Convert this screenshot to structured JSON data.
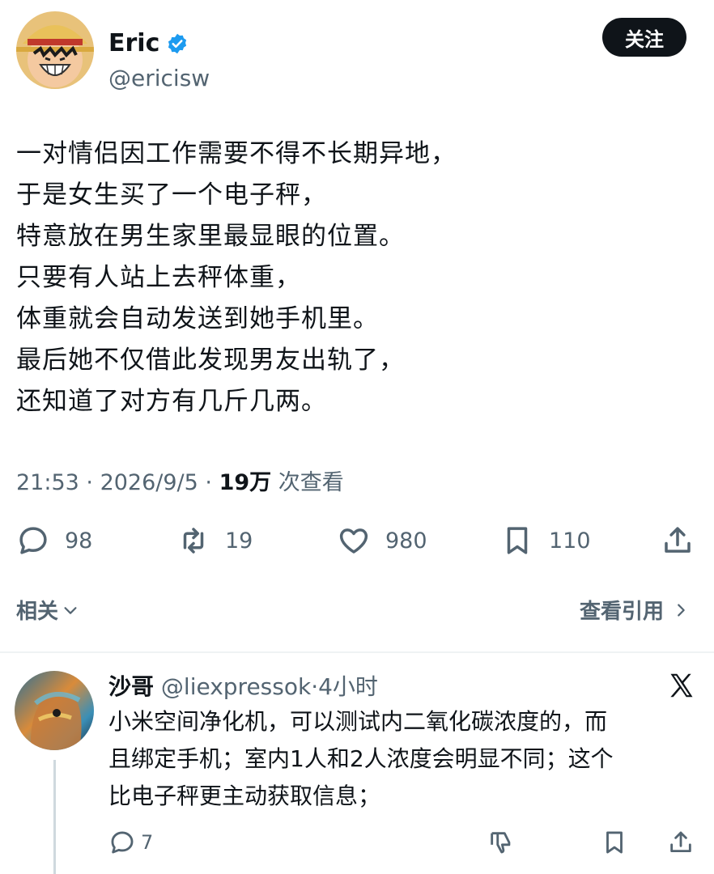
{
  "post": {
    "author": {
      "name": "Eric",
      "handle": "@ericisw"
    },
    "follow_label": "关注",
    "lines": [
      "一对情侣因工作需要不得不长期异地，",
      "于是女生买了一个电子秤，",
      "特意放在男生家里最显眼的位置。",
      "只要有人站上去秤体重，",
      "体重就会自动发送到她手机里。",
      "最后她不仅借此发现男友出轨了，",
      "还知道了对方有几斤几两。"
    ],
    "meta": {
      "time": "21:53",
      "separator": " · ",
      "date": "2026/9/5",
      "views_count": "19万",
      "views_label": " 次查看"
    },
    "actions": {
      "replies": "98",
      "reposts": "19",
      "likes": "980",
      "bookmarks": "110"
    }
  },
  "related": {
    "left_label": "相关",
    "right_label": "查看引用"
  },
  "reply": {
    "name": "沙哥",
    "handle": "@liexpressok",
    "separator": "·",
    "time": "4小时",
    "lines": [
      "小米空间净化机，可以测试内二氧化碳浓度的，而",
      "且绑定手机；室内1人和2人浓度会明显不同；这个",
      "比电子秤更主动获取信息；"
    ],
    "reply_count": "7"
  },
  "colors": {
    "text": "#0f1419",
    "secondary": "#536471",
    "verified": "#1d9bf0",
    "divider": "#eff3f4"
  },
  "icons": [
    "verified-icon",
    "reply-icon",
    "repost-icon",
    "like-icon",
    "bookmark-icon",
    "share-icon",
    "chevron-down-icon",
    "chevron-right-icon",
    "x-logo-icon",
    "dislike-icon"
  ]
}
